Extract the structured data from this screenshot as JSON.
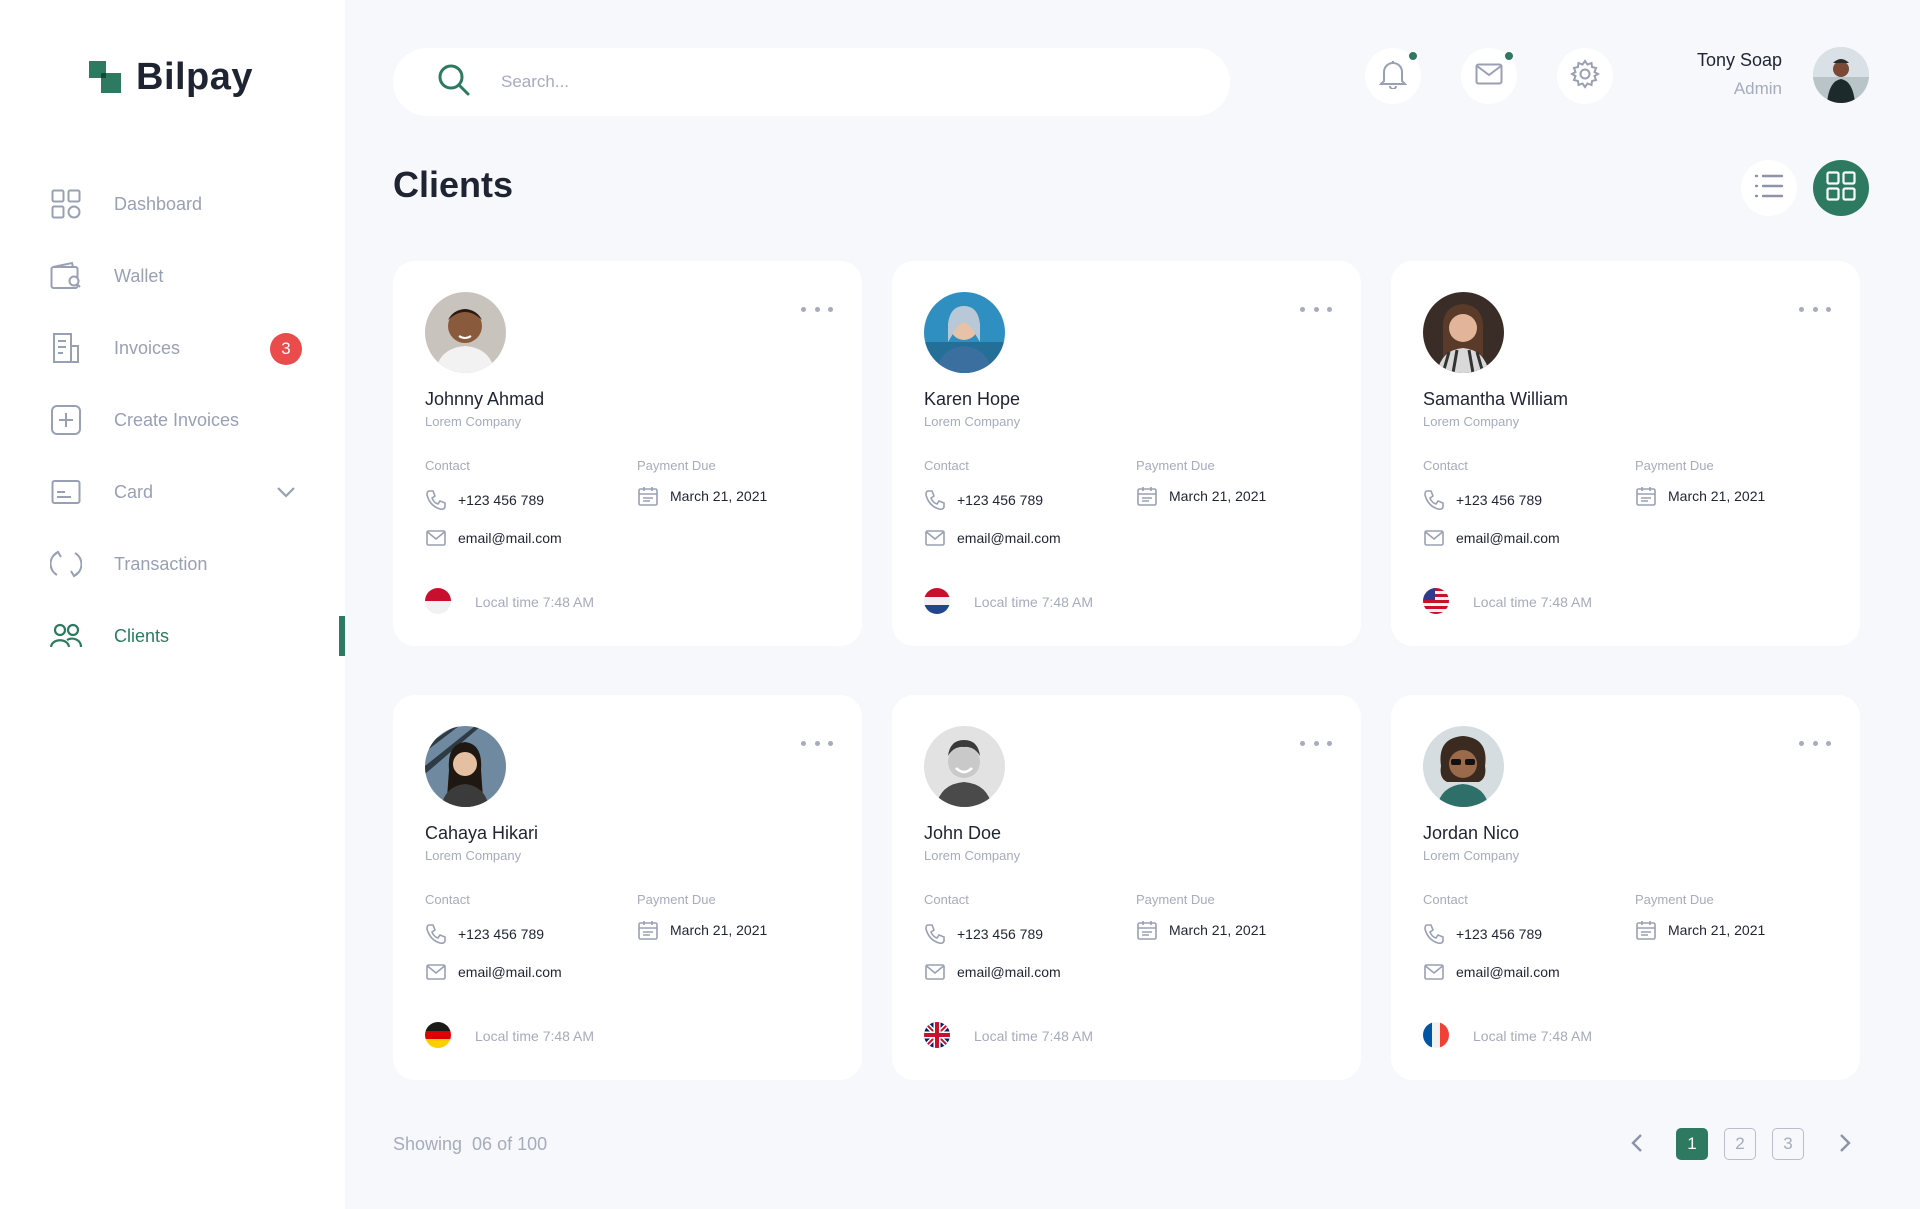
{
  "brand": {
    "name": "Bilpay",
    "accent": "#2d7a60",
    "badge_color": "#ea4b4b"
  },
  "sidebar": {
    "items": [
      {
        "label": "Dashboard",
        "icon": "grid-icon",
        "active": false
      },
      {
        "label": "Wallet",
        "icon": "wallet-icon",
        "active": false
      },
      {
        "label": "Invoices",
        "icon": "invoice-icon",
        "active": false,
        "badge": "3"
      },
      {
        "label": "Create Invoices",
        "icon": "plus-square-icon",
        "active": false
      },
      {
        "label": "Card",
        "icon": "card-icon",
        "active": false,
        "expandable": true
      },
      {
        "label": "Transaction",
        "icon": "refresh-icon",
        "active": false
      },
      {
        "label": "Clients",
        "icon": "users-icon",
        "active": true
      }
    ]
  },
  "header": {
    "search_placeholder": "Search...",
    "user": {
      "name": "Tony Soap",
      "role": "Admin"
    }
  },
  "page": {
    "title": "Clients",
    "view_mode": "grid"
  },
  "clients": [
    {
      "name": "Johnny Ahmad",
      "company": "Lorem Company",
      "contact_label": "Contact",
      "phone": "+123 456 789",
      "email": "email@mail.com",
      "due_label": "Payment Due",
      "due_date": "March 21, 2021",
      "local_time": "Local time 7:48 AM",
      "flag": "indonesia-flag-icon"
    },
    {
      "name": "Karen Hope",
      "company": "Lorem Company",
      "contact_label": "Contact",
      "phone": "+123 456 789",
      "email": "email@mail.com",
      "due_label": "Payment Due",
      "due_date": "March 21, 2021",
      "local_time": "Local time 7:48 AM",
      "flag": "netherlands-flag-icon"
    },
    {
      "name": "Samantha William",
      "company": "Lorem Company",
      "contact_label": "Contact",
      "phone": "+123 456 789",
      "email": "email@mail.com",
      "due_label": "Payment Due",
      "due_date": "March 21, 2021",
      "local_time": "Local time 7:48 AM",
      "flag": "usa-flag-icon"
    },
    {
      "name": "Cahaya Hikari",
      "company": "Lorem Company",
      "contact_label": "Contact",
      "phone": "+123 456 789",
      "email": "email@mail.com",
      "due_label": "Payment Due",
      "due_date": "March 21, 2021",
      "local_time": "Local time 7:48 AM",
      "flag": "germany-flag-icon"
    },
    {
      "name": "John Doe",
      "company": "Lorem Company",
      "contact_label": "Contact",
      "phone": "+123 456 789",
      "email": "email@mail.com",
      "due_label": "Payment Due",
      "due_date": "March 21, 2021",
      "local_time": "Local time 7:48 AM",
      "flag": "uk-flag-icon"
    },
    {
      "name": "Jordan Nico",
      "company": "Lorem Company",
      "contact_label": "Contact",
      "phone": "+123 456 789",
      "email": "email@mail.com",
      "due_label": "Payment Due",
      "due_date": "March 21, 2021",
      "local_time": "Local time 7:48 AM",
      "flag": "france-flag-icon"
    }
  ],
  "footer": {
    "showing": "Showing  06 of 100",
    "pages": [
      "1",
      "2",
      "3"
    ],
    "current_page": "1"
  }
}
